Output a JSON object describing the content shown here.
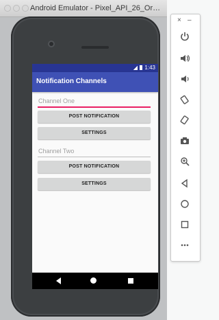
{
  "emulator": {
    "title": "Android Emulator - Pixel_API_26_Oreo:..."
  },
  "status_bar": {
    "time": "1:43"
  },
  "app": {
    "title": "Notification Channels",
    "channel_one": {
      "hint": "Channel One",
      "post_button": "POST NOTIFICATION",
      "settings_button": "SETTINGS"
    },
    "channel_two": {
      "hint": "Channel Two",
      "post_button": "POST NOTIFICATION",
      "settings_button": "SETTINGS"
    },
    "colors": {
      "primary": "#3f51b5",
      "primary_dark": "#283593",
      "accent": "#e91e63"
    }
  },
  "toolbar": {
    "close_glyph": "×",
    "minimize_glyph": "–",
    "icons": [
      "power-icon",
      "volume-up-icon",
      "volume-down-icon",
      "rotate-left-icon",
      "rotate-right-icon",
      "camera-icon",
      "zoom-icon",
      "back-icon",
      "home-icon",
      "overview-icon",
      "more-icon"
    ]
  }
}
